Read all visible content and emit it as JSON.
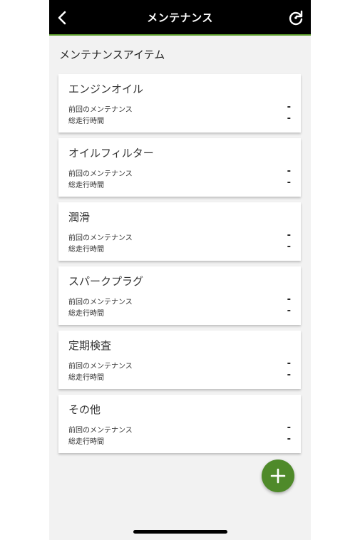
{
  "header": {
    "title": "メンテナンス"
  },
  "section_title": "メンテナンスアイテム",
  "cards": [
    {
      "title": "エンジンオイル",
      "row1_label": "前回のメンテナンス",
      "row1_value": "-",
      "row2_label": "総走行時間",
      "row2_value": "-"
    },
    {
      "title": "オイルフィルター",
      "row1_label": "前回のメンテナンス",
      "row1_value": "-",
      "row2_label": "総走行時間",
      "row2_value": "-"
    },
    {
      "title": "潤滑",
      "row1_label": "前回のメンテナンス",
      "row1_value": "-",
      "row2_label": "総走行時間",
      "row2_value": "-"
    },
    {
      "title": "スパークプラグ",
      "row1_label": "前回のメンテナンス",
      "row1_value": "-",
      "row2_label": "総走行時間",
      "row2_value": "-"
    },
    {
      "title": "定期検査",
      "row1_label": "前回のメンテナンス",
      "row1_value": "-",
      "row2_label": "総走行時間",
      "row2_value": "-"
    },
    {
      "title": "その他",
      "row1_label": "前回のメンテナンス",
      "row1_value": "-",
      "row2_label": "総走行時間",
      "row2_value": "-"
    }
  ],
  "icons": {
    "back": "chevron-left-icon",
    "refresh": "refresh-icon",
    "add": "plus-icon"
  },
  "colors": {
    "header_bg": "#000000",
    "accent": "#4f8a2a",
    "screen_bg": "#f2f2f2"
  }
}
